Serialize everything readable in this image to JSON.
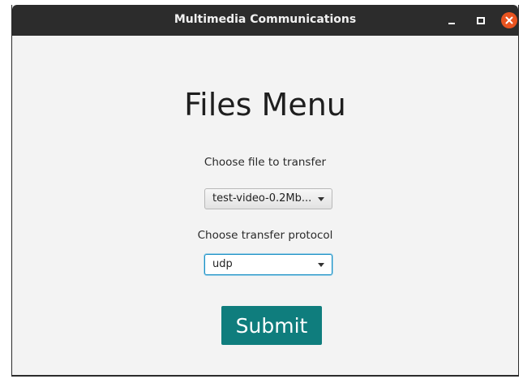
{
  "window": {
    "title": "Multimedia Communications"
  },
  "titlebar_buttons": {
    "minimize_icon": "minimize-icon",
    "maximize_icon": "maximize-icon",
    "close_icon": "close-icon",
    "close_color": "#e95420"
  },
  "main": {
    "heading": "Files Menu",
    "file_label": "Choose file to transfer",
    "file_selected": "test-video-0.2Mb...",
    "protocol_label": "Choose transfer protocol",
    "protocol_selected": "udp",
    "submit_label": "Submit"
  },
  "colors": {
    "submit_bg": "#0f7d7d",
    "titlebar_bg": "#2c2c2c",
    "focus_border": "#1a8fc4"
  }
}
